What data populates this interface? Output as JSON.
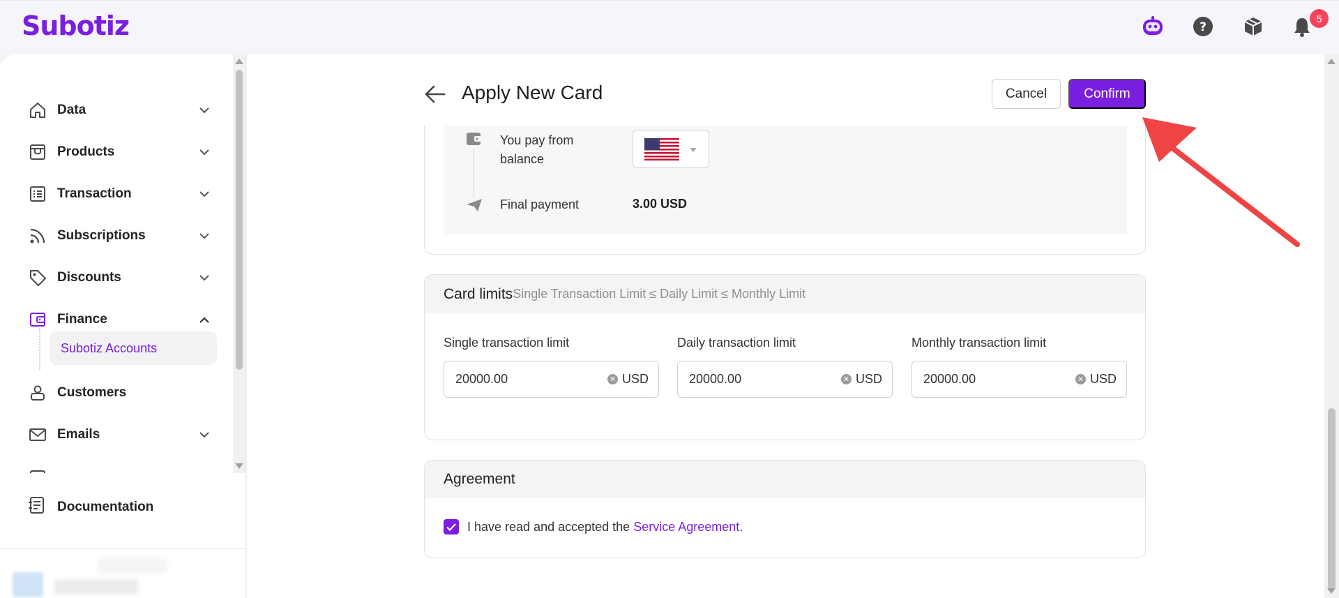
{
  "header": {
    "logo": "Subotiz",
    "notification_count": "5"
  },
  "sidebar": {
    "items": [
      {
        "label": "Data",
        "icon": "home-icon",
        "expanded": false
      },
      {
        "label": "Products",
        "icon": "store-icon",
        "expanded": false
      },
      {
        "label": "Transaction",
        "icon": "list-icon",
        "expanded": false
      },
      {
        "label": "Subscriptions",
        "icon": "rss-icon",
        "expanded": false
      },
      {
        "label": "Discounts",
        "icon": "tag-icon",
        "expanded": false
      },
      {
        "label": "Finance",
        "icon": "wallet-icon",
        "expanded": true
      },
      {
        "label": "Customers",
        "icon": "user-icon",
        "expanded": false
      },
      {
        "label": "Emails",
        "icon": "mail-icon",
        "expanded": false
      }
    ],
    "active_subitem": "Subotiz Accounts",
    "documentation": "Documentation"
  },
  "page": {
    "title": "Apply New Card",
    "cancel_label": "Cancel",
    "confirm_label": "Confirm"
  },
  "payment": {
    "pay_from_label": "You pay from balance",
    "final_payment_label": "Final payment",
    "final_payment_value": "3.00 USD"
  },
  "card_limits": {
    "title": "Card limits",
    "subtitle": "Single Transaction Limit ≤ Daily Limit ≤ Monthly Limit",
    "fields": [
      {
        "label": "Single transaction limit",
        "value": "20000.00",
        "unit": "USD"
      },
      {
        "label": "Daily transaction limit",
        "value": "20000.00",
        "unit": "USD"
      },
      {
        "label": "Monthly transaction limit",
        "value": "20000.00",
        "unit": "USD"
      }
    ]
  },
  "agreement": {
    "title": "Agreement",
    "text_prefix": "I have read and accepted the ",
    "link_text": "Service Agreement",
    "text_suffix": ".",
    "checked": true
  },
  "colors": {
    "brand": "#7a1fe0",
    "annotation_arrow": "#ef4444",
    "badge": "#f5455c"
  }
}
